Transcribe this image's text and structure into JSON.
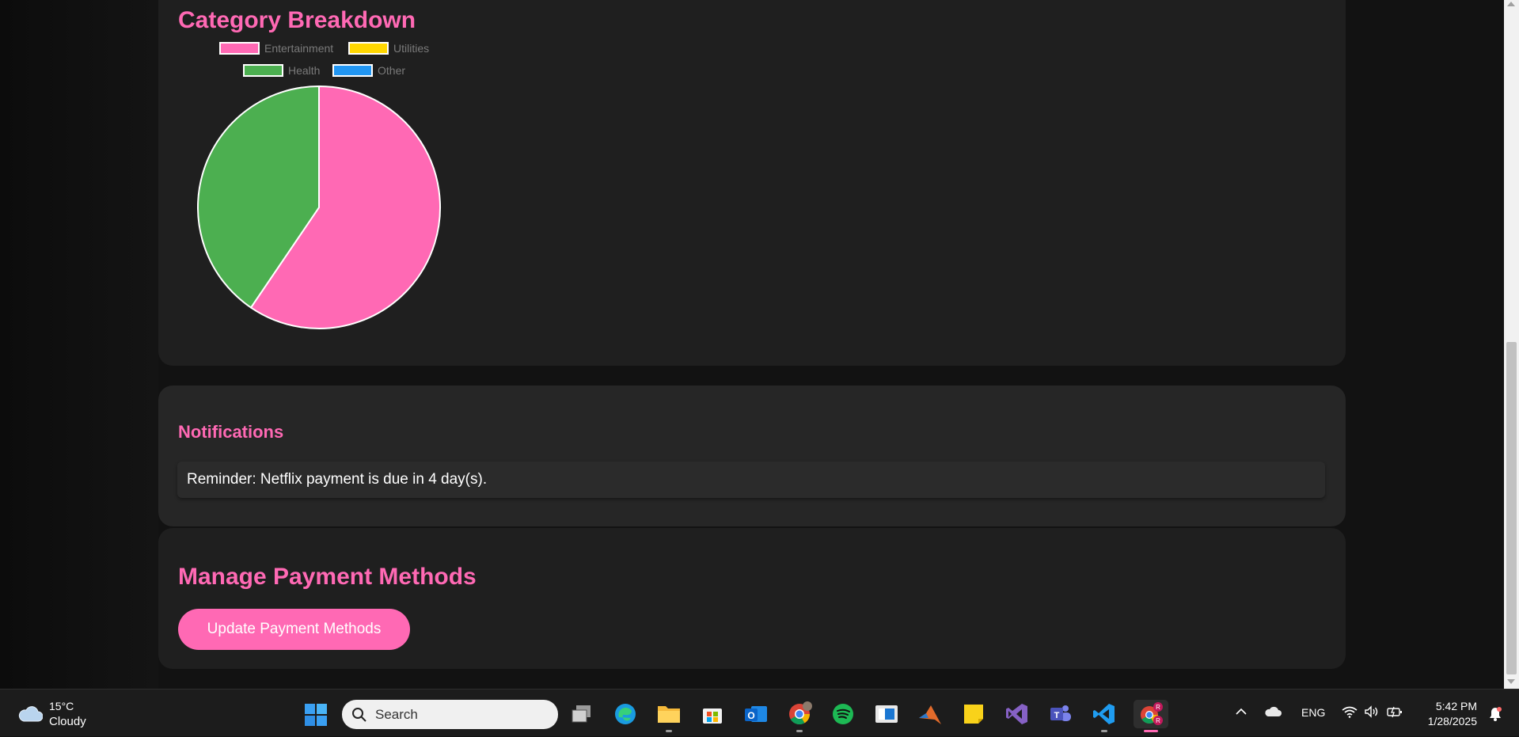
{
  "category": {
    "title": "Category Breakdown",
    "legend": [
      {
        "label": "Entertainment",
        "color": "#ff69b4"
      },
      {
        "label": "Utilities",
        "color": "#ffd700"
      },
      {
        "label": "Health",
        "color": "#4caf50"
      },
      {
        "label": "Other",
        "color": "#2196f3"
      }
    ]
  },
  "chart_data": {
    "type": "pie",
    "title": "",
    "categories": [
      "Entertainment",
      "Utilities",
      "Health",
      "Other"
    ],
    "values": [
      59.5,
      0,
      40.5,
      0
    ],
    "colors": [
      "#ff69b4",
      "#ffd700",
      "#4caf50",
      "#2196f3"
    ],
    "legend_position": "top"
  },
  "notifications": {
    "title": "Notifications",
    "items": [
      "Reminder: Netflix payment is due in 4 day(s)."
    ]
  },
  "payment": {
    "title": "Manage Payment Methods",
    "button_label": "Update Payment Methods"
  },
  "taskbar": {
    "weather_temp": "15°C",
    "weather_desc": "Cloudy",
    "search_placeholder": "Search",
    "apps": [
      "task-view",
      "edge",
      "file-explorer",
      "microsoft-store",
      "outlook",
      "chrome",
      "spotify",
      "screen-app",
      "matlab",
      "sticky-notes",
      "visual-studio",
      "teams",
      "vscode",
      "chrome-profile"
    ],
    "language": "ENG",
    "time": "5:42 PM",
    "date": "1/28/2025"
  }
}
